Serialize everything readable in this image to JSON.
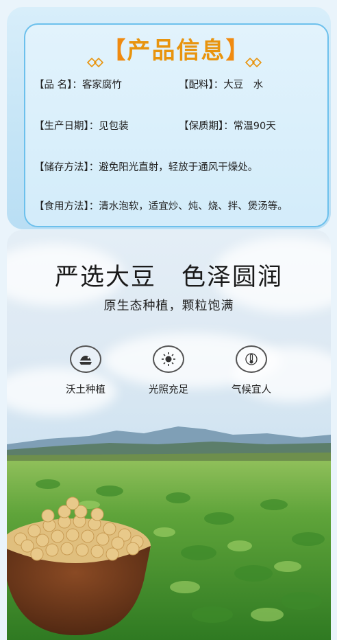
{
  "info": {
    "title_left_bracket": "【",
    "title_text": "产品信息",
    "title_right_bracket": "】",
    "rows": [
      {
        "label": "【品 名】：",
        "value": "客家腐竹"
      },
      {
        "label": "【配料】：",
        "value": "大豆　水"
      },
      {
        "label": "【生产日期】：",
        "value": "见包装"
      },
      {
        "label": "【保质期】：",
        "value": "常温90天"
      },
      {
        "label": "【储存方法】：",
        "value": "避免阳光直射，轻放于通风干燥处。"
      },
      {
        "label": "【食用方法】：",
        "value": "清水泡软，适宜炒、炖、烧、拌、煲汤等。"
      }
    ]
  },
  "feature": {
    "headline": "严选大豆　色泽圆润",
    "subtitle": "原生态种植，颗粒饱满",
    "items": [
      {
        "icon": "soil-icon",
        "label": "沃土种植"
      },
      {
        "icon": "sun-icon",
        "label": "光照充足"
      },
      {
        "icon": "thermometer-icon",
        "label": "气候宜人"
      }
    ]
  },
  "colors": {
    "accent": "#e8940e",
    "card_border": "#6cc0ec",
    "card_bg": "#d8eefa"
  }
}
